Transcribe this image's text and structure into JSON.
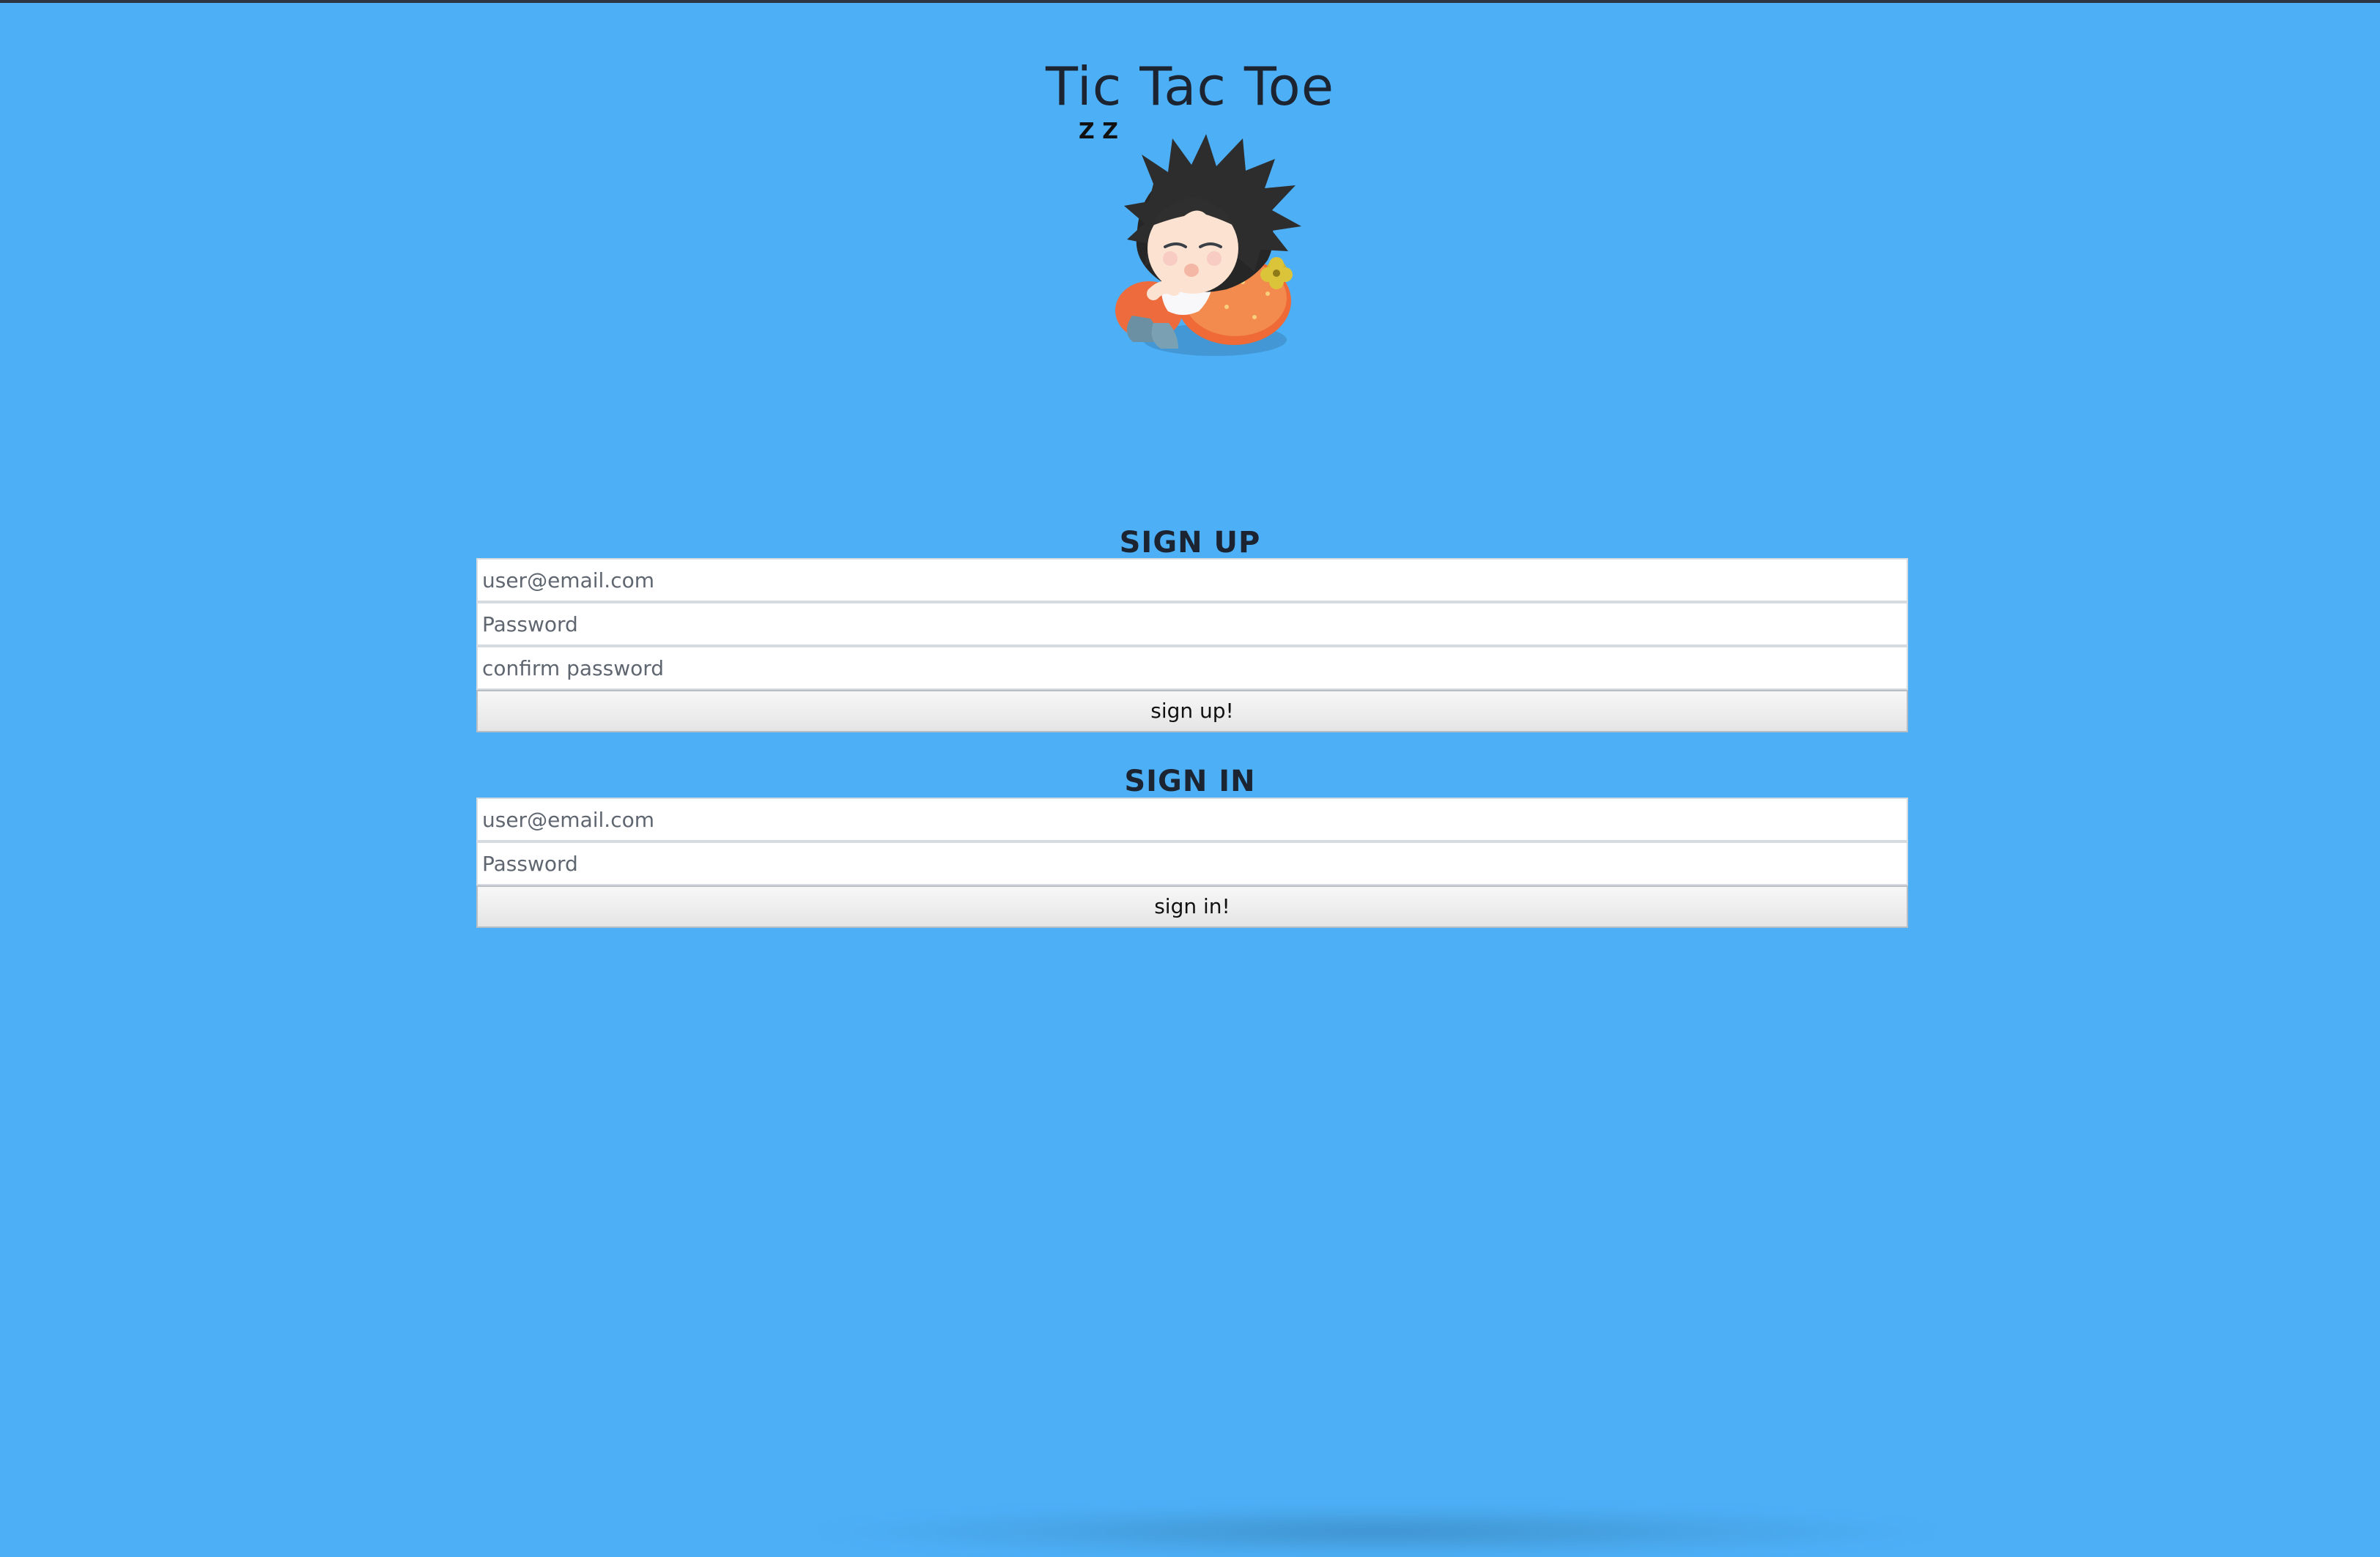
{
  "page": {
    "title": "Tic Tac Toe",
    "accent_color": "#4db0f7"
  },
  "hero": {
    "sleep_mark": "Z Z",
    "mascot_name": "sleeping-character-icon"
  },
  "signup": {
    "heading": "SIGN UP",
    "email_placeholder": "user@email.com",
    "password_placeholder": "Password",
    "confirm_placeholder": "confirm password",
    "button_label": "sign up!"
  },
  "signin": {
    "heading": "SIGN IN",
    "email_placeholder": "user@email.com",
    "password_placeholder": "Password",
    "button_label": "sign in!"
  }
}
